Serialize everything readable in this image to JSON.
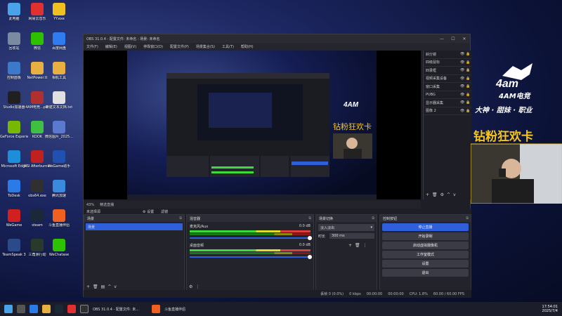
{
  "desktop_icons": [
    {
      "label": "此电脑",
      "color": "#4aa3e8"
    },
    {
      "label": "网易云音乐",
      "color": "#e03030"
    },
    {
      "label": "YY.exe",
      "color": "#f0c020"
    },
    {
      "label": "回收站",
      "color": "#7a8aa0"
    },
    {
      "label": "微信",
      "color": "#2dc100"
    },
    {
      "label": "百度网盘",
      "color": "#2f7bf0"
    },
    {
      "label": "控制面板",
      "color": "#3a7ac8"
    },
    {
      "label": "NetPower.tt",
      "color": "#e8b040"
    },
    {
      "label": "相机工具",
      "color": "#e8b040"
    },
    {
      "label": "Studio加速器",
      "color": "#202020"
    },
    {
      "label": "4AM电竞...pdf",
      "color": "#b03030"
    },
    {
      "label": "新建文本文档.txt",
      "color": "#e0e0e0"
    },
    {
      "label": "GeForce Experience",
      "color": "#76b900"
    },
    {
      "label": "KOOK",
      "color": "#40c040"
    },
    {
      "label": "微信图片_2025...",
      "color": "#5a7ad0"
    },
    {
      "label": "Microsoft Edge",
      "color": "#1c8fd8"
    },
    {
      "label": "MSI Afterburner",
      "color": "#c02020"
    },
    {
      "label": "WeGame助手",
      "color": "#2050b0"
    },
    {
      "label": "ToDesk",
      "color": "#2a7ae8"
    },
    {
      "label": "obs64.exe",
      "color": "#303030"
    },
    {
      "label": "腾讯加速",
      "color": "#3a8ae0"
    },
    {
      "label": "WeGame",
      "color": "#d02020"
    },
    {
      "label": "steam",
      "color": "#1b2838"
    },
    {
      "label": "斗鱼直播伴侣",
      "color": "#f06020"
    },
    {
      "label": "TeamSpeak 3",
      "color": "#2a4a8a"
    },
    {
      "label": "三角洲行动",
      "color": "#2a3a2a"
    },
    {
      "label": "WeChatase",
      "color": "#2dc100"
    }
  ],
  "obs": {
    "title": "OBS 31.0.4 - 配置文件: 未命名 - 场景: 未命名",
    "menu": [
      "文件(F)",
      "编辑(E)",
      "视图(V)",
      "停靠窗口(D)",
      "配置文件(P)",
      "场景集合(S)",
      "工具(T)",
      "帮助(H)"
    ],
    "preview_status": [
      "43%",
      "精选直播"
    ],
    "current_scene": "未选择源",
    "properties_btn": "⚙ 设置",
    "filters_btn": "滤镜",
    "sources": [
      {
        "name": "斜分镜",
        "v": "👁",
        "l": "🔒"
      },
      {
        "name": "四级鼠标",
        "v": "👁",
        "l": "🔒"
      },
      {
        "name": "四录框",
        "v": "👁",
        "l": "🔒"
      },
      {
        "name": "视频采集设备",
        "v": "👁",
        "l": "🔒"
      },
      {
        "name": "窗口采集",
        "v": "👁",
        "l": "🔒"
      },
      {
        "name": "PUBG",
        "v": "👁",
        "l": "🔒"
      },
      {
        "name": "显示器采集",
        "v": "👁",
        "l": "🔒"
      },
      {
        "name": "图像 2",
        "v": "👁",
        "l": "🔒"
      }
    ],
    "scenes_title": "场景",
    "scenes": [
      "场景"
    ],
    "mixer_title": "混音器",
    "mixer": [
      {
        "name": "麦克风/Aux",
        "db": "0.0 dB"
      },
      {
        "name": "桌面音频",
        "db": "0.0 dB"
      }
    ],
    "transitions_title": "场景切换",
    "transition_type": "淡入淡出",
    "duration_label": "时长",
    "duration": "300 ms",
    "controls_title": "控制按钮",
    "controls": [
      "停止直播",
      "开始录制",
      "启动虚拟摄像机",
      "工作室模式",
      "设置",
      "退出"
    ],
    "status": {
      "dropped": "丢帧 0 (0.0%)",
      "kbps": "0 kbps",
      "rec": "00:00:00",
      "live": "00:00:00",
      "cpu": "CPU: 1.8%",
      "fps": "60.00 / 60.00 FPS"
    }
  },
  "overlay": {
    "logo": "4AM电竞",
    "slogan": "大神 · 甜妹 · 职业",
    "banner": "钻粉狂欢卡"
  },
  "taskbar": {
    "app": "OBS 31.0.4 - 配置文件: 未...",
    "app2": "斗鱼直播伴侣",
    "time": "17:54:01",
    "date": "2025/7/4"
  },
  "colors": {
    "accent": "#2f5fdb",
    "banner": "#f5c518"
  }
}
